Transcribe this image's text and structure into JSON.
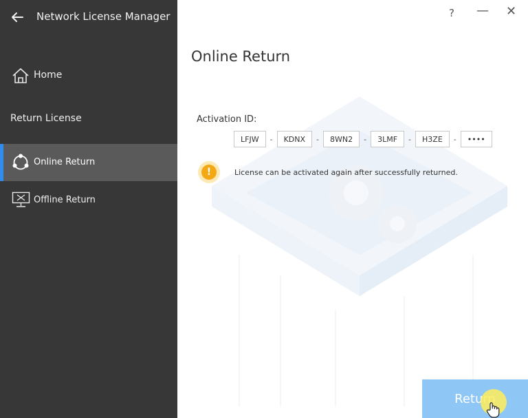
{
  "app": {
    "title": "Network License Manager"
  },
  "window_controls": {
    "help": "?",
    "minimize": "—",
    "close": "✕"
  },
  "sidebar": {
    "home_label": "Home",
    "section_label": "Return License",
    "items": [
      {
        "label": "Online Return",
        "icon": "online-return-icon",
        "selected": true
      },
      {
        "label": "Offline Return",
        "icon": "offline-return-icon",
        "selected": false
      }
    ]
  },
  "main": {
    "title": "Online Return",
    "activation_label": "Activation ID:",
    "segments": [
      "LFJW",
      "KDNX",
      "8WN2",
      "3LMF",
      "H3ZE",
      "••••"
    ],
    "separator": "-",
    "notice": "License can be activated again after successfully returned.",
    "return_button": "Return"
  },
  "colors": {
    "sidebar_bg": "#373737",
    "selected_bg": "#5a5a5a",
    "accent": "#2f8cf0",
    "button_bg": "#8ec7f5",
    "warning": "#f4a814"
  }
}
